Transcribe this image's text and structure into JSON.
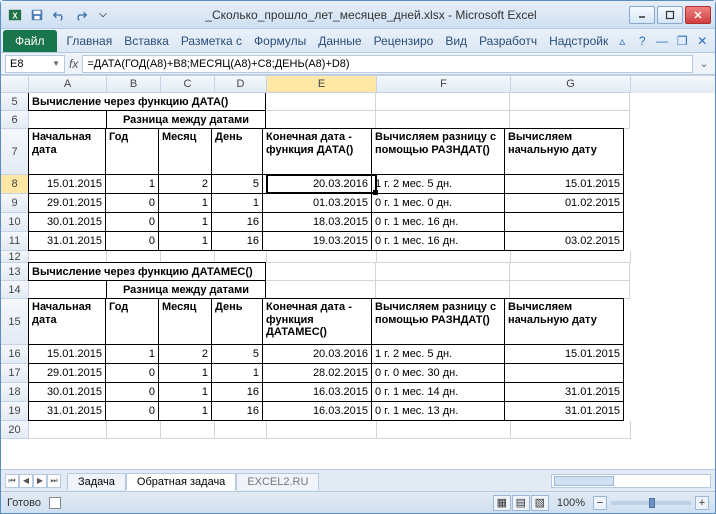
{
  "title": "_Сколько_прошло_лет_месяцев_дней.xlsx - Microsoft Excel",
  "ribbon": {
    "file": "Файл",
    "tabs": [
      "Главная",
      "Вставка",
      "Разметка с",
      "Формулы",
      "Данные",
      "Рецензиро",
      "Вид",
      "Разработч",
      "Надстройк"
    ]
  },
  "namebox": "E8",
  "formula": "=ДАТА(ГОД(A8)+B8;МЕСЯЦ(A8)+C8;ДЕНЬ(A8)+D8)",
  "columns": [
    "A",
    "B",
    "C",
    "D",
    "E",
    "F",
    "G"
  ],
  "row_numbers": [
    "5",
    "6",
    "7",
    "8",
    "9",
    "10",
    "11",
    "12",
    "13",
    "14",
    "15",
    "16",
    "17",
    "18",
    "19"
  ],
  "section1_title": "Вычисление через функцию ДАТА()",
  "section2_title": "Вычисление через функцию ДАТАМЕС()",
  "diff_header": "Разница между датами",
  "headers": {
    "start": "Начальная дата",
    "year": "Год",
    "month": "Месяц",
    "day": "День",
    "end1": "Конечная дата - функция ДАТА()",
    "end2": "Конечная дата - функция ДАТАМЕС()",
    "razndat": "Вычисляем разницу с помощью РАЗНДАТ()",
    "calcstart": "Вычисляем начальную дату"
  },
  "table1": [
    {
      "a": "15.01.2015",
      "b": "1",
      "c": "2",
      "d": "5",
      "e": "20.03.2016",
      "f": "1 г. 2 мес. 5 дн.",
      "g": "15.01.2015"
    },
    {
      "a": "29.01.2015",
      "b": "0",
      "c": "1",
      "d": "1",
      "e": "01.03.2015",
      "f": "0 г. 1 мес. 0 дн.",
      "g": "01.02.2015"
    },
    {
      "a": "30.01.2015",
      "b": "0",
      "c": "1",
      "d": "16",
      "e": "18.03.2015",
      "f": "0 г. 1 мес. 16 дн.",
      "g": ""
    },
    {
      "a": "31.01.2015",
      "b": "0",
      "c": "1",
      "d": "16",
      "e": "19.03.2015",
      "f": "0 г. 1 мес. 16 дн.",
      "g": "03.02.2015"
    }
  ],
  "table2": [
    {
      "a": "15.01.2015",
      "b": "1",
      "c": "2",
      "d": "5",
      "e": "20.03.2016",
      "f": "1 г. 2 мес. 5 дн.",
      "g": "15.01.2015"
    },
    {
      "a": "29.01.2015",
      "b": "0",
      "c": "1",
      "d": "1",
      "e": "28.02.2015",
      "f": "0 г. 0 мес. 30 дн.",
      "g": ""
    },
    {
      "a": "30.01.2015",
      "b": "0",
      "c": "1",
      "d": "16",
      "e": "16.03.2015",
      "f": "0 г. 1 мес. 14 дн.",
      "g": "31.01.2015"
    },
    {
      "a": "31.01.2015",
      "b": "0",
      "c": "1",
      "d": "16",
      "e": "16.03.2015",
      "f": "0 г. 1 мес. 13 дн.",
      "g": "31.01.2015"
    }
  ],
  "sheets": {
    "s1": "Задача",
    "s2": "Обратная задача",
    "s3": "EXCEL2.RU"
  },
  "status": "Готово",
  "zoom": "100%"
}
